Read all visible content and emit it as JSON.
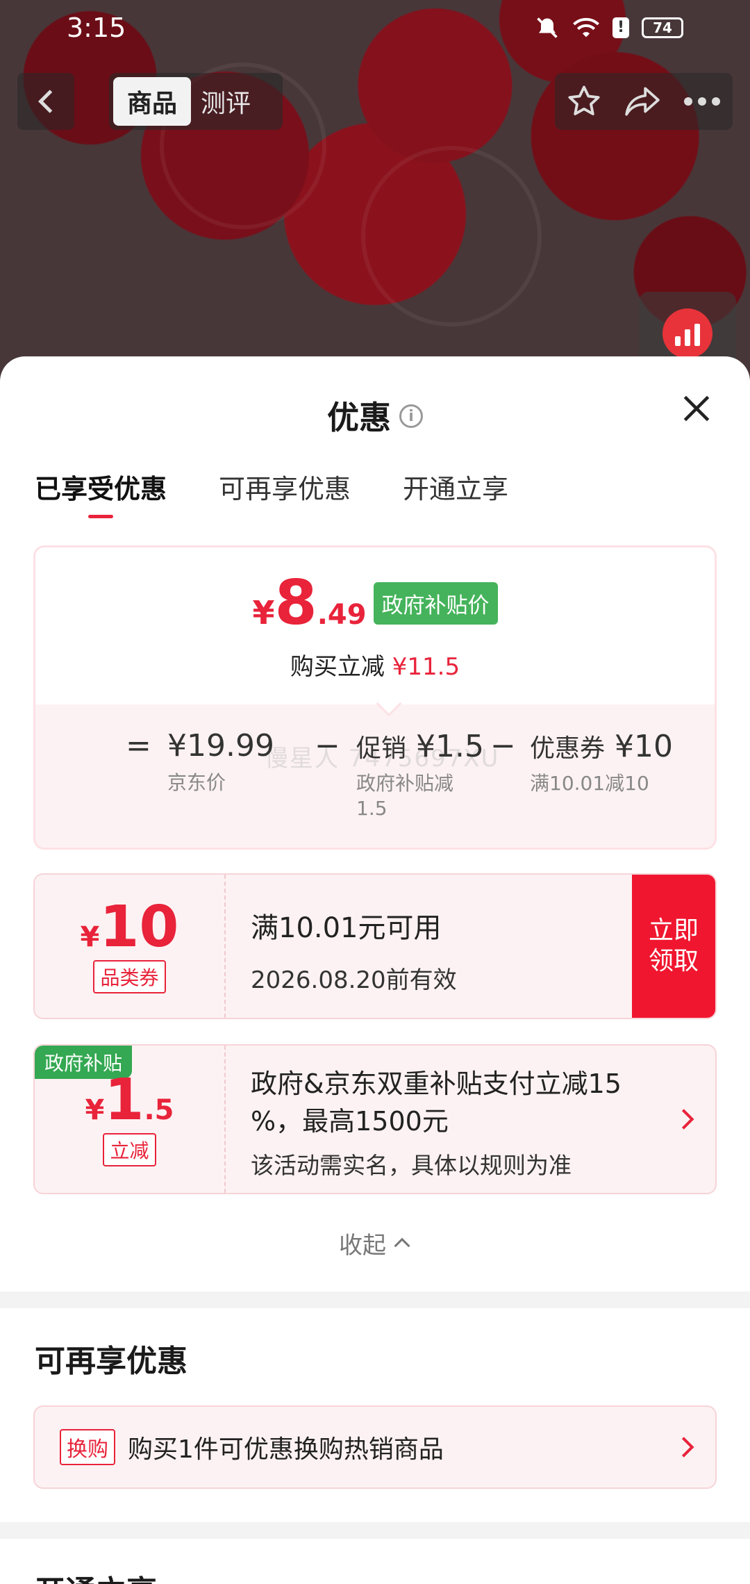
{
  "status_bar": {
    "time": "3:15",
    "battery": "74"
  },
  "top_nav": {
    "tab_active": "商品",
    "tab_inactive": "测评"
  },
  "sheet": {
    "title": "优惠",
    "tabs": [
      "已享受优惠",
      "可再享优惠",
      "开通立享"
    ],
    "active_tab_index": 0
  },
  "price_card": {
    "final_yen": "¥",
    "final_int": "8",
    "final_dec": ".49",
    "gov_tag": "政府补贴价",
    "reduce_prefix": "购买立减",
    "reduce_amount": "¥11.5",
    "formula": {
      "eq": "=",
      "jd_price": "¥19.99",
      "jd_price_label": "京东价",
      "minus": "−",
      "promo_label": "促销",
      "promo_amount": "¥1.5",
      "promo_sub_line1": "政府补贴减",
      "promo_sub_line2": "1.5",
      "coupon_label": "优惠券",
      "coupon_amount": "¥10",
      "coupon_sub": "满10.01减10"
    },
    "watermark": "慢星人 7475697XU"
  },
  "coupon_1": {
    "yen": "¥",
    "value": "10",
    "tag": "品类券",
    "condition": "满10.01元可用",
    "valid_until": "2026.08.20前有效",
    "button": "立即领取",
    "button_line1": "立即",
    "button_line2": "领取"
  },
  "coupon_2": {
    "corner": "政府补贴",
    "yen": "¥",
    "value_int": "1",
    "value_dec": ".5",
    "tag": "立减",
    "desc_line1": "政府&京东双重补贴支付立减15",
    "desc_line2": "%，最高1500元",
    "note": "该活动需实名，具体以规则为准"
  },
  "collapse_label": "收起",
  "more_offers": {
    "title": "可再享优惠",
    "tag": "换购",
    "text": "购买1件可优惠换购热销商品"
  },
  "instant": {
    "title": "开通立享"
  },
  "colors": {
    "accent_red": "#e8233a",
    "gov_green": "#45b35b",
    "card_pink": "#fdf2f3"
  }
}
